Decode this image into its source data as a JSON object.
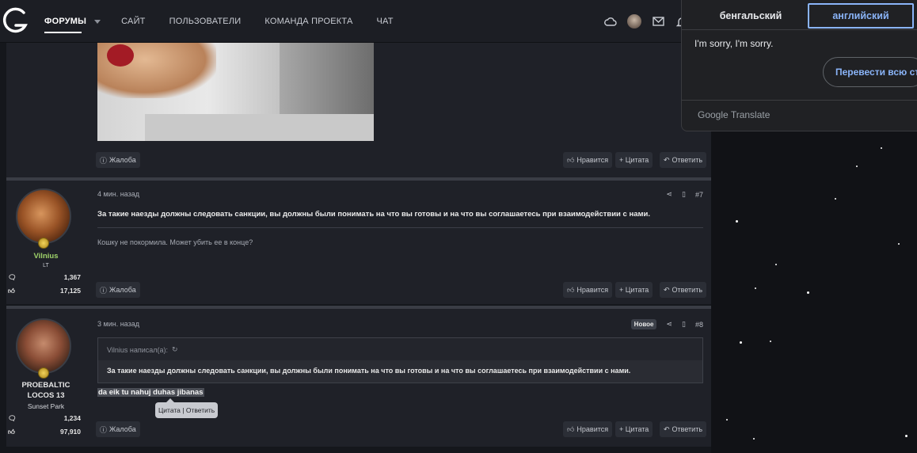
{
  "nav": {
    "items": [
      {
        "label": "ФОРУМЫ",
        "active": true
      },
      {
        "label": "САЙТ"
      },
      {
        "label": "ПОЛЬЗОВАТЕЛИ"
      },
      {
        "label": "КОМАНДА ПРОЕКТА"
      },
      {
        "label": "ЧАТ"
      }
    ],
    "icons": [
      "cloud-icon",
      "avatar",
      "mail-icon",
      "bell-icon"
    ]
  },
  "actions": {
    "report": "Жалоба",
    "like": "Нравится",
    "quote": "+ Цитата",
    "reply": "Ответить"
  },
  "posts": [
    {
      "number": "#7",
      "time": "4 мин. назад",
      "text": "За такие наезды должны следовать санкции, вы должны были понимать на что вы готовы и на что вы соглашаетесь при взаимодействии с нами.",
      "signature": "Кошку не покормила. Может убить ее в конце?",
      "user": {
        "name": "Vilnius",
        "tag": "LT",
        "messages": "1,367",
        "likes": "17,125"
      }
    },
    {
      "number": "#8",
      "time": "3 мин. назад",
      "badge": "Новое",
      "quote_author": "Vilnius написал(а):",
      "quote_text": "За такие наезды должны следовать санкции, вы должны были понимать на что вы готовы и на что вы соглашаетесь при взаимодействии с нами.",
      "text": "da eik tu nahuj duhas jibanas",
      "tooltip": "Цитата | Ответить",
      "user": {
        "name_line1": "PROEBALTIC",
        "name_line2": "LOCOS 13",
        "location": "Sunset Park",
        "messages": "1,234",
        "likes": "97,910"
      }
    }
  ],
  "translate": {
    "tab_source": "бенгальский",
    "tab_target": "английский",
    "result": "I'm sorry, I'm sorry.",
    "translate_all": "Перевести всю ст",
    "brand": "Google Translate"
  },
  "colors": {
    "background": "#15171c",
    "post_bg": "#1f2128",
    "accent_green": "#9fd36a",
    "google_blue": "#8ab4f8"
  }
}
